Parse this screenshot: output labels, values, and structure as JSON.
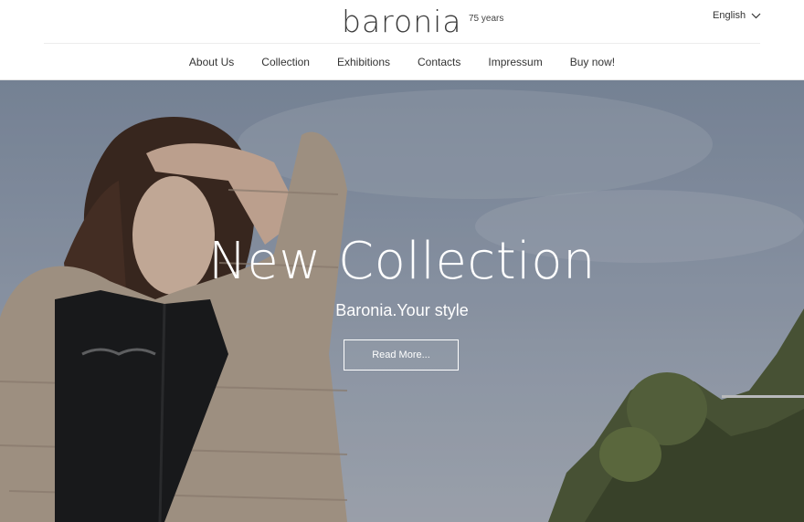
{
  "header": {
    "logo": "baronia",
    "tagline": "75 years",
    "language": "English"
  },
  "nav": {
    "items": [
      "About Us",
      "Collection",
      "Exhibitions",
      "Contacts",
      "Impressum",
      "Buy now!"
    ]
  },
  "hero": {
    "title": "New Collection",
    "subtitle": "Baronia.Your style",
    "button": "Read More..."
  },
  "colors": {
    "sky": "#95a1b3",
    "jacket": "#b3a08c",
    "text_dark": "#333333"
  },
  "icons": {
    "language_chevron": "chevron-down-icon"
  }
}
